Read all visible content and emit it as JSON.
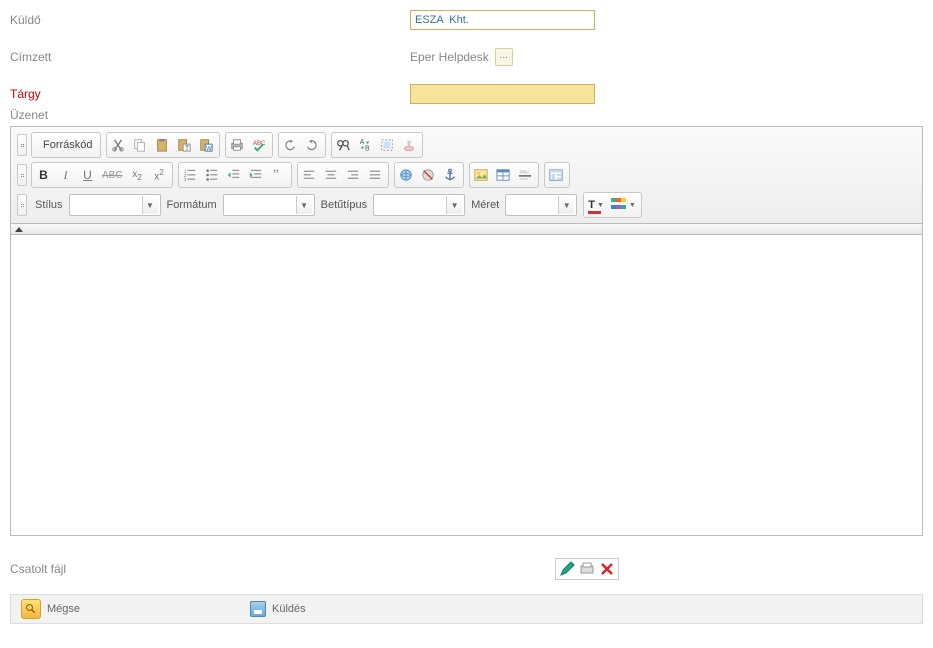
{
  "labels": {
    "sender": "Küldő",
    "recipient": "Címzett",
    "subject": "Tárgy",
    "message": "Üzenet",
    "attached": "Csatolt fájl"
  },
  "form": {
    "sender_value": "ESZA  Kht.",
    "recipient_value": "Eper Helpdesk",
    "more": "...",
    "subject_value": ""
  },
  "toolbar": {
    "source": "Forráskód",
    "style_label": "Stílus",
    "format_label": "Formátum",
    "font_label": "Betűtípus",
    "size_label": "Méret"
  },
  "buttons": {
    "cancel": "Mégse",
    "send": "Küldés"
  }
}
